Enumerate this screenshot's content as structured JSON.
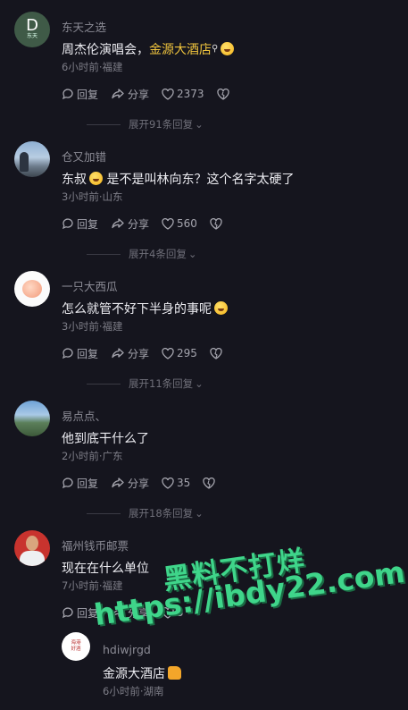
{
  "comments": [
    {
      "username": "东天之选",
      "avatar_text": "D",
      "avatar_sub": "东天",
      "text_before": "周杰伦演唱会，",
      "text_link": "金源大酒店",
      "text_after": "",
      "time": "6小时前·福建",
      "reply_label": "回复",
      "share_label": "分享",
      "likes": "2373",
      "expand": "展开91条回复"
    },
    {
      "username": "仓又加错",
      "text_before": "东叔",
      "text_after": " 是不是叫林向东？这个名字太硬了",
      "time": "3小时前·山东",
      "reply_label": "回复",
      "share_label": "分享",
      "likes": "560",
      "expand": "展开4条回复"
    },
    {
      "username": "一只大西瓜",
      "text": "怎么就管不好下半身的事呢",
      "time": "3小时前·福建",
      "reply_label": "回复",
      "share_label": "分享",
      "likes": "295",
      "expand": "展开11条回复"
    },
    {
      "username": "易点点、",
      "text": "他到底干什么了",
      "time": "2小时前·广东",
      "reply_label": "回复",
      "share_label": "分享",
      "likes": "35",
      "expand": "展开18条回复"
    },
    {
      "username": "福州钱币邮票",
      "text": "现在在什么单位",
      "time": "7小时前·福建",
      "reply_label": "回复",
      "share_label": "分享",
      "likes": "5"
    }
  ],
  "reply": {
    "username": "hdiwjrgd",
    "avatar_text": "海港\n好酒",
    "text": "金源大酒店",
    "time": "6小时前·湖南"
  },
  "watermark": {
    "line1": "黑料不打烊",
    "line2": "https://ibdy22.com"
  },
  "colors": {
    "background": "#15151e",
    "highlight": "#f0c43d",
    "watermark": "#3fd58a"
  }
}
